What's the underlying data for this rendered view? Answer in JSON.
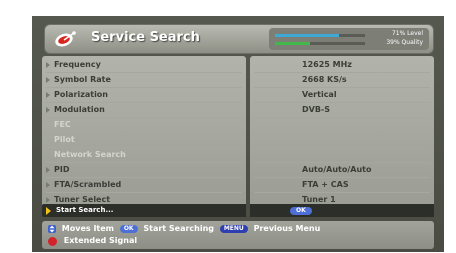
{
  "header": {
    "title": "Service Search",
    "level_text": "71% Level",
    "quality_text": "39% Quality",
    "level": 0.71,
    "quality": 0.39,
    "colors": {
      "level_bar": "#3fa9d6",
      "quality_bar": "#43b84a"
    }
  },
  "menu": {
    "rows": [
      {
        "label": "Frequency",
        "value": "12625 MHz",
        "enabled": true
      },
      {
        "label": "Symbol Rate",
        "value": "2668 KS/s",
        "enabled": true
      },
      {
        "label": "Polarization",
        "value": "Vertical",
        "enabled": true
      },
      {
        "label": "Modulation",
        "value": "DVB-S",
        "enabled": true
      },
      {
        "label": "FEC",
        "value": "",
        "enabled": false
      },
      {
        "label": "Pilot",
        "value": "",
        "enabled": false
      },
      {
        "label": "Network Search",
        "value": "",
        "enabled": false
      },
      {
        "label": "PID",
        "value": "Auto/Auto/Auto",
        "enabled": true
      },
      {
        "label": "FTA/Scrambled",
        "value": "FTA + CAS",
        "enabled": true
      },
      {
        "label": "Tuner Select",
        "value": "Tuner 1",
        "enabled": true
      }
    ],
    "selected": {
      "label": "Start Search...",
      "button": "OK"
    }
  },
  "footer": {
    "moves_item": "Moves Item",
    "ok_key": "OK",
    "start_searching": "Start Searching",
    "menu_key": "MENU",
    "previous_menu": "Previous Menu",
    "extended_signal": "Extended Signal"
  }
}
